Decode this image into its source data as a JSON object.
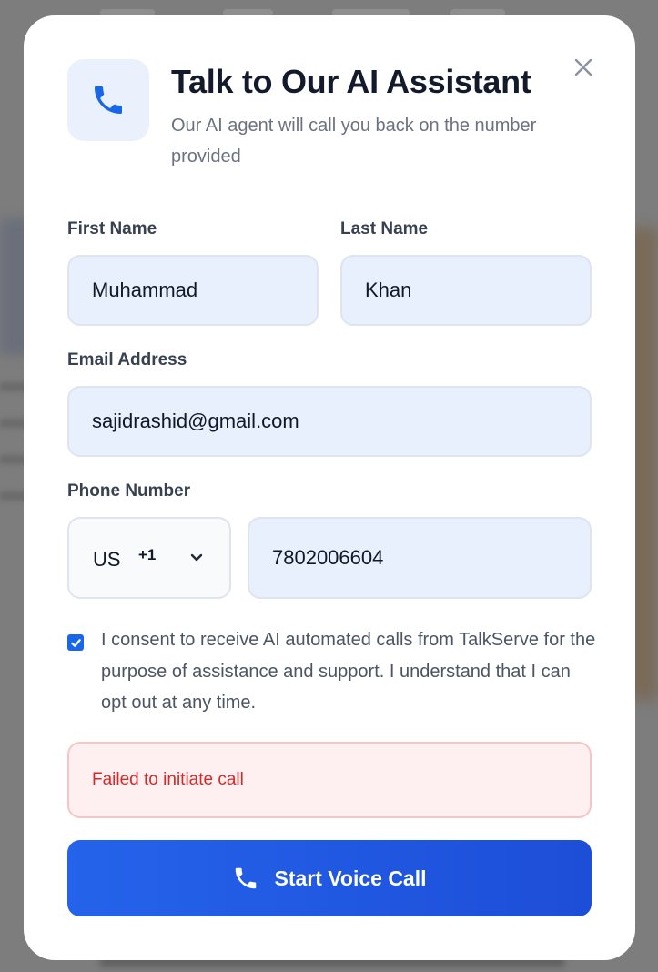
{
  "modal": {
    "title": "Talk to Our AI Assistant",
    "subtitle": "Our AI agent will call you back on the number provided",
    "header_icon": "phone-icon",
    "close_icon": "close-icon"
  },
  "form": {
    "first_name": {
      "label": "First Name",
      "value": "Muhammad"
    },
    "last_name": {
      "label": "Last Name",
      "value": "Khan"
    },
    "email": {
      "label": "Email Address",
      "value": "sajidrashid@gmail.com"
    },
    "phone": {
      "label": "Phone Number",
      "country_code": "US",
      "dial_code": "+1",
      "value": "7802006604",
      "chevron_icon": "chevron-down-icon"
    },
    "consent": {
      "checked": true,
      "text": "I consent to receive AI automated calls from TalkServe for the purpose of assistance and support. I understand that I can opt out at any time."
    }
  },
  "error": {
    "message": "Failed to initiate call"
  },
  "submit": {
    "label": "Start Voice Call",
    "icon": "phone-icon"
  },
  "colors": {
    "accent": "#2563eb",
    "error_text": "#d42a2a",
    "error_bg": "#fef0f0",
    "input_bg": "#e8effd"
  }
}
